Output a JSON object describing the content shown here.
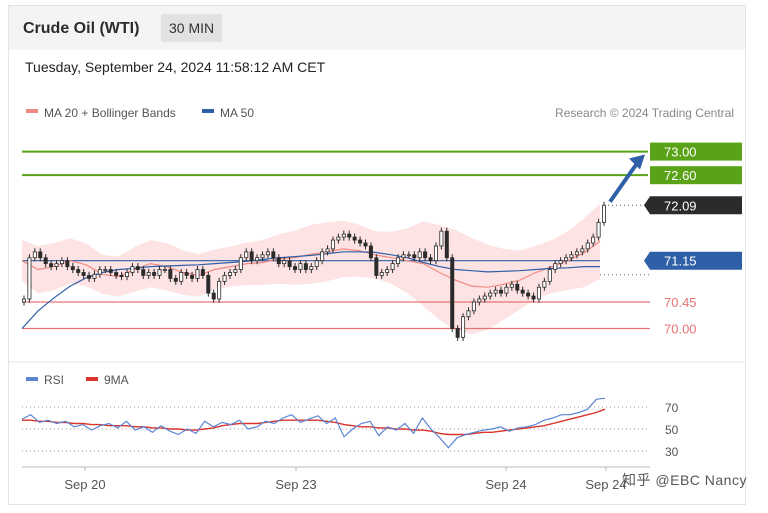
{
  "header": {
    "title": "Crude Oil (WTI)",
    "timeframe": "30 MIN"
  },
  "datetime": "Tuesday, September 24, 2024 11:58:12 AM CET",
  "credit": "Research © 2024 Trading Central",
  "watermark": "知乎 @EBC Nancy",
  "colors": {
    "support_resistance_green": "#5aa317",
    "support_red": "#e57373",
    "ma50_blue": "#2f5fa7",
    "bollinger_fill": "#fde0e0",
    "candle": "#2b2b2b",
    "rsi_blue": "#5b86d6",
    "rsi_ma_red": "#d9342b",
    "current_price_bg": "#2b2b2b",
    "arrow": "#2f5fa7"
  },
  "chart_data": [
    {
      "type": "candlestick",
      "legend": [
        {
          "name": "MA 20 + Bollinger Bands",
          "color": "#f28b82"
        },
        {
          "name": "MA 50",
          "color": "#2f5fa7"
        }
      ],
      "x_tick_labels": [
        "Sep 20",
        "Sep 23",
        "Sep 24",
        "Sep 24"
      ],
      "y_range": [
        69.5,
        73.4
      ],
      "levels": [
        {
          "value": 73.0,
          "label": "73.00",
          "kind": "resistance",
          "color": "#5aa317"
        },
        {
          "value": 72.6,
          "label": "72.60",
          "kind": "resistance",
          "color": "#5aa317"
        },
        {
          "value": 72.09,
          "label": "72.09",
          "kind": "current",
          "color": "#2b2b2b"
        },
        {
          "value": 71.15,
          "label": "71.15",
          "kind": "pivot",
          "color": "#2f5fa7"
        },
        {
          "value": 70.45,
          "label": "70.45",
          "kind": "support",
          "color": "#e57373"
        },
        {
          "value": 70.0,
          "label": "70.00",
          "kind": "support",
          "color": "#e57373"
        }
      ],
      "series": [
        {
          "name": "MA 20 + Bollinger Bands",
          "values": [
            71.15,
            71.0,
            71.05,
            71.15,
            71.08,
            70.92,
            70.88,
            71.0,
            71.1,
            71.05,
            70.95,
            70.9,
            71.0,
            71.05,
            71.1,
            71.12,
            71.18,
            71.2,
            71.26,
            71.3,
            71.35,
            71.32,
            71.25,
            71.2,
            71.15,
            71.1,
            70.95,
            70.82,
            70.72,
            70.7,
            70.75,
            70.82,
            70.95,
            71.05,
            71.15,
            71.28,
            71.48
          ]
        },
        {
          "name": "MA 50",
          "values": [
            70.0,
            70.3,
            70.52,
            70.72,
            70.86,
            70.95,
            71.0,
            71.02,
            71.05,
            71.06,
            71.07,
            71.08,
            71.1,
            71.12,
            71.14,
            71.17,
            71.2,
            71.22,
            71.24,
            71.27,
            71.3,
            71.3,
            71.29,
            71.25,
            71.2,
            71.12,
            71.05,
            71.0,
            70.98,
            70.96,
            70.97,
            70.98,
            71.0,
            71.02,
            71.03,
            71.05,
            71.05
          ]
        }
      ],
      "arrow": {
        "from_value": 72.15,
        "to_value": 72.95
      }
    },
    {
      "type": "line",
      "legend": [
        {
          "name": "RSI",
          "color": "#5b86d6"
        },
        {
          "name": "9MA",
          "color": "#d9342b"
        }
      ],
      "y_tick_labels": [
        "70",
        "50",
        "30"
      ],
      "y_range": [
        20,
        80
      ],
      "series": [
        {
          "name": "RSI",
          "values": [
            59,
            63,
            56,
            58,
            55,
            57,
            52,
            54,
            49,
            53,
            55,
            51,
            57,
            49,
            52,
            47,
            53,
            48,
            45,
            50,
            46,
            57,
            52,
            56,
            54,
            58,
            50,
            52,
            57,
            55,
            60,
            63,
            56,
            59,
            62,
            55,
            60,
            43,
            50,
            55,
            57,
            44,
            52,
            49,
            55,
            46,
            60,
            50,
            42,
            33,
            42,
            45,
            47,
            49,
            50,
            52,
            48,
            51,
            52,
            54,
            58,
            60,
            63,
            63,
            65,
            68,
            77,
            78
          ]
        },
        {
          "name": "9MA",
          "values": [
            58,
            58,
            57,
            57,
            56,
            56,
            55,
            55,
            54,
            54,
            53,
            53,
            53,
            52,
            52,
            51,
            51,
            50,
            50,
            49,
            49,
            50,
            51,
            53,
            54,
            55,
            55,
            55,
            56,
            57,
            58,
            58,
            58,
            58,
            58,
            57,
            56,
            54,
            53,
            52,
            52,
            51,
            51,
            50,
            50,
            49,
            49,
            48,
            46,
            45,
            45,
            45,
            46,
            47,
            47,
            48,
            49,
            50,
            51,
            52,
            53,
            55,
            57,
            59,
            61,
            63,
            65,
            68
          ]
        }
      ]
    }
  ]
}
